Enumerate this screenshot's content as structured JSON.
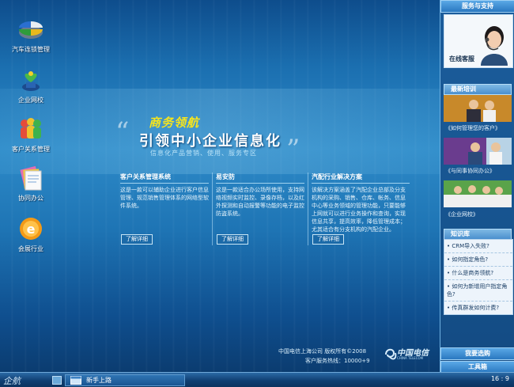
{
  "desktop_icons": [
    {
      "label": "汽车连锁管理",
      "icon": "pie-chart-icon"
    },
    {
      "label": "企业网校",
      "icon": "sprout-icon"
    },
    {
      "label": "客户关系管理",
      "icon": "people-icon"
    },
    {
      "label": "协同办公",
      "icon": "documents-icon"
    },
    {
      "label": "会展行业",
      "icon": "e-logo-icon"
    }
  ],
  "hero": {
    "title": "商务领航",
    "main": "引领中小企业信息化",
    "subtitle": "信息化产品营销、使用、服务专区",
    "open_quote": "“",
    "close_quote": "”"
  },
  "columns": [
    {
      "title": "客户关系管理系统",
      "body": "这是一款可以辅助企业进行客户信息管理、规范销售管理体系的网络型软件系统。",
      "button": "了解详细"
    },
    {
      "title": "易安防",
      "body": "这是一款适合办公场所使用，支持网络视频实时监控、录像存档，以及红外探测和自动报警等功能的电子监控防盗系统。",
      "button": "了解详细"
    },
    {
      "title": "汽配行业解决方案",
      "body": "该解决方案涵盖了汽配企业总部及分支机构的采购、销售、仓库、帐务、信息中心等业务领域的管理功能，只要能够上网就可以进行业务操作和查询，实现信息共享，提高效率，降低管理成本；尤其适合有分支机构的汽配企业。",
      "button": "了解详细"
    }
  ],
  "footer": {
    "copyright": "中国电信上海公司  版权所有©2008",
    "hotline": "客户服务热线：10000+9",
    "brand_cn": "中国电信",
    "brand_en": "CHINA TELECOM"
  },
  "right_panel": {
    "service_header": "服务与支持",
    "online_service": "在线客服",
    "training_header": "最新培训",
    "trainings": [
      "《如何管理您的客户》",
      "《与同事协同办公》",
      "《企业网校》"
    ],
    "knowledge_header": "知识库",
    "knowledge_items": [
      "CRM导入失败?",
      "如何指定角色?",
      "什么是商务领航?",
      "如何为新增用户指定角色?",
      "传真群发如何计费?"
    ],
    "suggest_button": "我要选购",
    "toolbox_button": "工具箱"
  },
  "taskbar": {
    "start_label": "企航",
    "task_label": "新手上路",
    "clock": "16 : 9"
  },
  "colors": {
    "accent_yellow": "#f7e51c",
    "panel_blue": "#17548f",
    "desktop_blue": "#2d8ac8"
  }
}
